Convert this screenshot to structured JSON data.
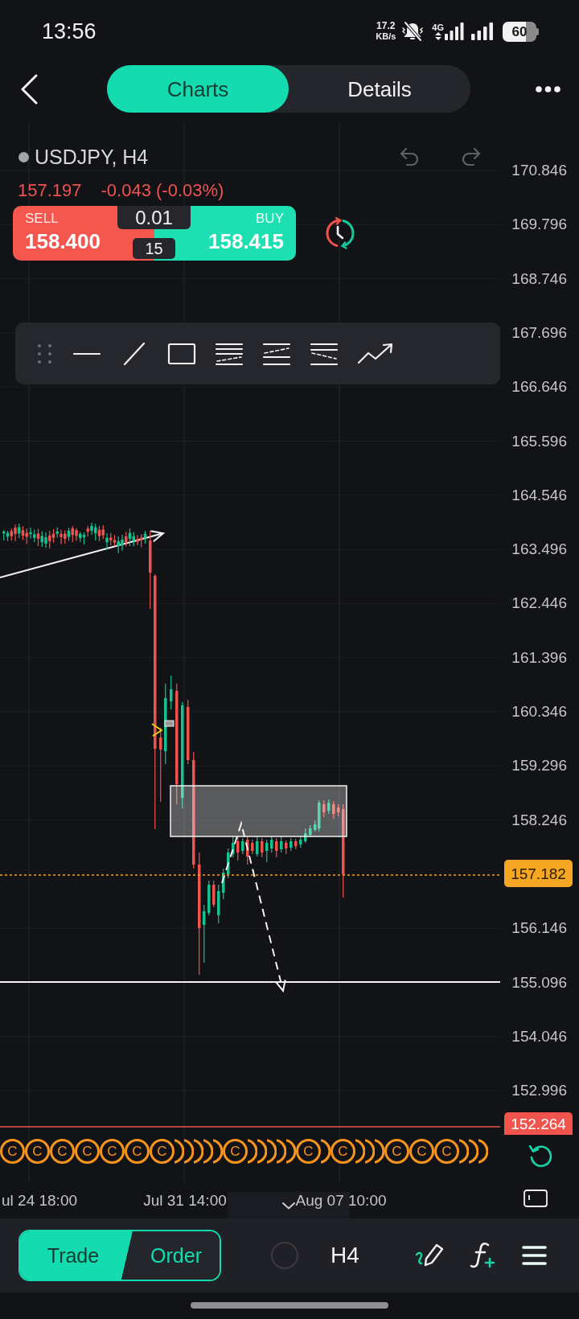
{
  "status_bar": {
    "time": "13:56",
    "net_speed": "17.2",
    "net_speed_unit": "KB/s",
    "network": "4G",
    "battery": "60"
  },
  "tabs": [
    {
      "label": "Charts",
      "selected": true
    },
    {
      "label": "Details",
      "selected": false
    }
  ],
  "instrument": {
    "title": "USDJPY, H4",
    "last_price": "157.197",
    "change": "-0.043 (-0.03%)"
  },
  "quote": {
    "sell_label": "SELL",
    "sell_price": "158.400",
    "lot": "0.01",
    "spread": "15",
    "buy_label": "BUY",
    "buy_price": "158.415"
  },
  "price_axis": {
    "ticks": [
      "170.846",
      "169.796",
      "168.746",
      "167.696",
      "166.646",
      "165.596",
      "164.546",
      "163.496",
      "162.446",
      "161.396",
      "160.346",
      "159.296",
      "158.246",
      "156.146",
      "155.096",
      "154.046",
      "152.996"
    ],
    "current_price": "157.182",
    "line_price": "152.264"
  },
  "event_markers": [
    {
      "kind": "labeled",
      "label": "C"
    },
    {
      "kind": "labeled",
      "label": "C"
    },
    {
      "kind": "labeled",
      "label": "C"
    },
    {
      "kind": "labeled",
      "label": "C"
    },
    {
      "kind": "labeled",
      "label": "C"
    },
    {
      "kind": "labeled",
      "label": "C"
    },
    {
      "kind": "labeled",
      "label": "C"
    },
    {
      "kind": "covered"
    },
    {
      "kind": "covered"
    },
    {
      "kind": "covered"
    },
    {
      "kind": "covered"
    },
    {
      "kind": "covered"
    },
    {
      "kind": "labeled",
      "label": "C"
    },
    {
      "kind": "covered"
    },
    {
      "kind": "covered"
    },
    {
      "kind": "covered"
    },
    {
      "kind": "covered"
    },
    {
      "kind": "covered"
    },
    {
      "kind": "labeled",
      "label": "C"
    },
    {
      "kind": "covered"
    },
    {
      "kind": "labeled",
      "label": "C"
    },
    {
      "kind": "covered"
    },
    {
      "kind": "covered"
    },
    {
      "kind": "covered"
    },
    {
      "kind": "labeled",
      "label": "C"
    },
    {
      "kind": "labeled",
      "label": "C"
    },
    {
      "kind": "labeled",
      "label": "C"
    },
    {
      "kind": "covered"
    },
    {
      "kind": "covered"
    },
    {
      "kind": "covered"
    }
  ],
  "time_axis": [
    "ul 24 18:00",
    "Jul 31 14:00",
    "Aug 07 10:00"
  ],
  "bottom_bar": {
    "modes": [
      {
        "label": "Trade",
        "selected": true
      },
      {
        "label": "Order",
        "selected": false
      }
    ],
    "timeframe": "H4"
  }
}
